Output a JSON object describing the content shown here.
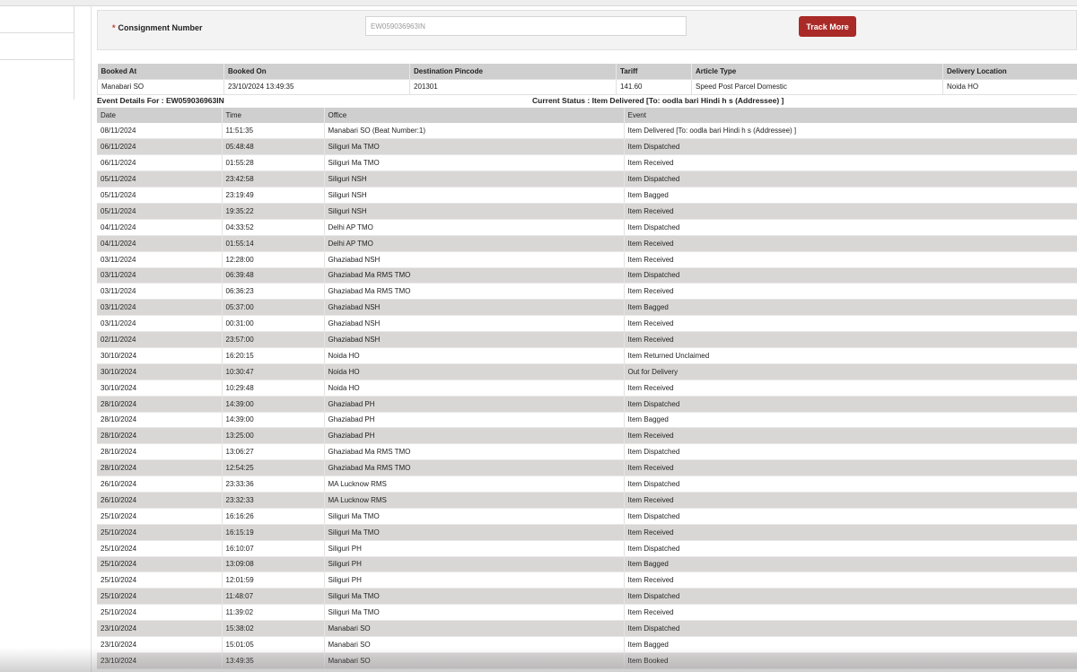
{
  "form": {
    "label": "Consignment Number",
    "required_mark": "*",
    "consignment_value": "EW059036963IN",
    "track_button": "Track More"
  },
  "booking": {
    "headers": [
      "Booked At",
      "Booked On",
      "Destination Pincode",
      "Tariff",
      "Article Type",
      "Delivery Location"
    ],
    "values": [
      "Manabari SO",
      "23/10/2024 13:49:35",
      "201301",
      "141.60",
      "Speed Post Parcel Domestic",
      "Noida HO"
    ]
  },
  "event_details": {
    "for_text": "Event Details For : EW059036963IN",
    "current_status": "Current Status : Item Delivered [To: oodla bari Hindi h s (Addressee) ]"
  },
  "events": {
    "headers": [
      "Date",
      "Time",
      "Office",
      "Event"
    ],
    "rows": [
      [
        "08/11/2024",
        "11:51:35",
        "Manabari SO (Beat Number:1)",
        "Item Delivered [To: oodla bari Hindi h s (Addressee) ]"
      ],
      [
        "06/11/2024",
        "05:48:48",
        "Siliguri Ma TMO",
        "Item Dispatched"
      ],
      [
        "06/11/2024",
        "01:55:28",
        "Siliguri Ma TMO",
        "Item Received"
      ],
      [
        "05/11/2024",
        "23:42:58",
        "Siliguri NSH",
        "Item Dispatched"
      ],
      [
        "05/11/2024",
        "23:19:49",
        "Siliguri NSH",
        "Item Bagged"
      ],
      [
        "05/11/2024",
        "19:35:22",
        "Siliguri NSH",
        "Item Received"
      ],
      [
        "04/11/2024",
        "04:33:52",
        "Delhi AP TMO",
        "Item Dispatched"
      ],
      [
        "04/11/2024",
        "01:55:14",
        "Delhi AP TMO",
        "Item Received"
      ],
      [
        "03/11/2024",
        "12:28:00",
        "Ghaziabad NSH",
        "Item Received"
      ],
      [
        "03/11/2024",
        "06:39:48",
        "Ghaziabad Ma RMS TMO",
        "Item Dispatched"
      ],
      [
        "03/11/2024",
        "06:36:23",
        "Ghaziabad Ma RMS TMO",
        "Item Received"
      ],
      [
        "03/11/2024",
        "05:37:00",
        "Ghaziabad NSH",
        "Item Bagged"
      ],
      [
        "03/11/2024",
        "00:31:00",
        "Ghaziabad NSH",
        "Item Received"
      ],
      [
        "02/11/2024",
        "23:57:00",
        "Ghaziabad NSH",
        "Item Received"
      ],
      [
        "30/10/2024",
        "16:20:15",
        "Noida HO",
        "Item Returned Unclaimed"
      ],
      [
        "30/10/2024",
        "10:30:47",
        "Noida HO",
        "Out for Delivery"
      ],
      [
        "30/10/2024",
        "10:29:48",
        "Noida HO",
        "Item Received"
      ],
      [
        "28/10/2024",
        "14:39:00",
        "Ghaziabad PH",
        "Item Dispatched"
      ],
      [
        "28/10/2024",
        "14:39:00",
        "Ghaziabad PH",
        "Item Bagged"
      ],
      [
        "28/10/2024",
        "13:25:00",
        "Ghaziabad PH",
        "Item Received"
      ],
      [
        "28/10/2024",
        "13:06:27",
        "Ghaziabad Ma RMS TMO",
        "Item Dispatched"
      ],
      [
        "28/10/2024",
        "12:54:25",
        "Ghaziabad Ma RMS TMO",
        "Item Received"
      ],
      [
        "26/10/2024",
        "23:33:36",
        "MA Lucknow RMS",
        "Item Dispatched"
      ],
      [
        "26/10/2024",
        "23:32:33",
        "MA Lucknow RMS",
        "Item Received"
      ],
      [
        "25/10/2024",
        "16:16:26",
        "Siliguri Ma TMO",
        "Item Dispatched"
      ],
      [
        "25/10/2024",
        "16:15:19",
        "Siliguri Ma TMO",
        "Item Received"
      ],
      [
        "25/10/2024",
        "16:10:07",
        "Siliguri PH",
        "Item Dispatched"
      ],
      [
        "25/10/2024",
        "13:09:08",
        "Siliguri PH",
        "Item Bagged"
      ],
      [
        "25/10/2024",
        "12:01:59",
        "Siliguri PH",
        "Item Received"
      ],
      [
        "25/10/2024",
        "11:48:07",
        "Siliguri Ma TMO",
        "Item Dispatched"
      ],
      [
        "25/10/2024",
        "11:39:02",
        "Siliguri Ma TMO",
        "Item Received"
      ],
      [
        "23/10/2024",
        "15:38:02",
        "Manabari SO",
        "Item Dispatched"
      ],
      [
        "23/10/2024",
        "15:01:05",
        "Manabari SO",
        "Item Bagged"
      ],
      [
        "23/10/2024",
        "13:49:35",
        "Manabari SO",
        "Item Booked"
      ]
    ]
  }
}
